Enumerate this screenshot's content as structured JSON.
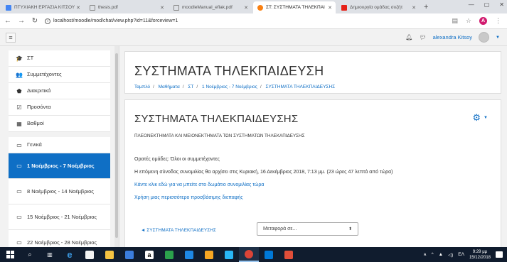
{
  "browser": {
    "tabs": [
      {
        "title": "ΠΤΥΧΙΑΚΗ ΕΡΓΑΣΙΑ ΚΙΤΣΟΥ",
        "favicon_color": "#4285f4"
      },
      {
        "title": "thesis.pdf",
        "favicon_color": "#888888"
      },
      {
        "title": "moodleManual_eflak.pdf",
        "favicon_color": "#888888"
      },
      {
        "title": "ΣΤ: ΣΥΣΤΗΜΑΤΑ ΤΗΛΕΚΠΑΙ",
        "favicon_color": "#f98012"
      },
      {
        "title": "Δημιουργία ομάδας συζήτ",
        "favicon_color": "#e62117"
      }
    ],
    "active_tab": 3,
    "url": "localhost/moodle/mod/chat/view.php?id=11&forceview=1"
  },
  "topbar": {
    "username": "alexandra Kitsoy"
  },
  "drawer": {
    "items": [
      {
        "icon": "graduation-cap-icon",
        "glyph": "🎓",
        "label": "ΣΤ",
        "active": false
      },
      {
        "icon": "users-icon",
        "glyph": "👥",
        "label": "Συμμετέχοντες",
        "active": false
      },
      {
        "icon": "badge-icon",
        "glyph": "⬟",
        "label": "Διακριτικά",
        "active": false
      },
      {
        "icon": "checkbox-icon",
        "glyph": "☑",
        "label": "Προσόντα",
        "active": false
      },
      {
        "icon": "grades-table-icon",
        "glyph": "▦",
        "label": "Βαθμοί",
        "active": false
      },
      {
        "icon": "folder-icon",
        "glyph": "▭",
        "label": "Γενικά",
        "active": false
      },
      {
        "icon": "folder-icon",
        "glyph": "▭",
        "label": "1 Νοέμβριος - 7 Νοέμβριος",
        "active": true
      },
      {
        "icon": "folder-icon",
        "glyph": "▭",
        "label": "8 Νοέμβριος - 14 Νοέμβριος",
        "active": false
      },
      {
        "icon": "folder-icon",
        "glyph": "▭",
        "label": "15 Νοέμβριος - 21 Νοέμβριος",
        "active": false
      },
      {
        "icon": "folder-icon",
        "glyph": "▭",
        "label": "22 Νοέμβριος - 28 Νοέμβριος",
        "active": false
      }
    ]
  },
  "header": {
    "course_title": "ΣΥΣΤΗΜΑΤΑ ΤΗΛΕΚΠΑΙΔΕΥΣΗ",
    "breadcrumb": [
      "Ταμπλό",
      "Μαθήματα",
      "ΣΤ",
      "1 Νοέμβριος - 7 Νοέμβριος",
      "ΣΥΣΤΗΜΑΤΑ ΤΗΛΕΚΠΑΙΔΕΥΣΗΣ"
    ]
  },
  "activity": {
    "title": "ΣΥΣΤΗΜΑΤΑ ΤΗΛΕΚΠΑΙΔΕΥΣΗΣ",
    "intro": "ΠΛΕΟΝΕΚΤΗΜΑΤΑ ΚΑΙ ΜΕΙΟΝΕΚΤΗΜΑΤΑ ΤΩΝ ΣΥΣΤΗΜΑΤΩΝ ΤΗΛΕΚΑΠΙΔΕΥΣΗΣ",
    "visible_groups": "Ορατές ομάδες: Όλοι οι συμμετέχοντες",
    "next_session": "Η επόμενη σύνοδος συνομιλίας θα αρχίσει στις Κυριακή, 16 Δεκέμβριος 2018, 7:13 μμ. (23 ώρες 47 λεπτά από τώρα)",
    "enter_link": "Κάντε κλικ εδώ για να μπείτε στο δωμάτιο συνομιλίας τώρα",
    "accessible_link": "Χρήση μιας περισσότερο προσβάσιμης διεπαφής",
    "prev_link": "◄ ΣΥΣΤΗΜΑΤΑ ΤΗΛΕΚΠΑΙΔΕΥΣΗΣ",
    "jump_placeholder": "Μεταφορά σε..."
  },
  "taskbar": {
    "language": "ΕΛ",
    "time": "9:29 μμ",
    "date": "15/12/2018"
  },
  "colors": {
    "moodle_blue": "#0f6fc5",
    "taskbar": "#101c2e"
  }
}
